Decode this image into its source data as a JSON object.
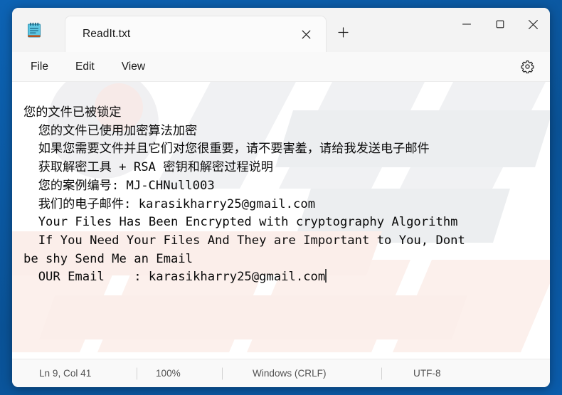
{
  "window": {
    "app_icon": "notepad-icon",
    "caption_buttons": [
      {
        "name": "minimize",
        "glyph": "minimize-icon"
      },
      {
        "name": "maximize",
        "glyph": "maximize-icon"
      },
      {
        "name": "close",
        "glyph": "close-icon"
      }
    ]
  },
  "tabs": {
    "active": {
      "label": "ReadIt.txt",
      "close_icon": "close-icon"
    },
    "new_tab_icon": "plus-icon"
  },
  "menubar": {
    "items": [
      {
        "label": "File"
      },
      {
        "label": "Edit"
      },
      {
        "label": "View"
      }
    ],
    "settings_icon": "gear-icon"
  },
  "editor": {
    "lines": [
      "您的文件已被锁定",
      "  您的文件已使用加密算法加密",
      "  如果您需要文件并且它们对您很重要，请不要害羞，请给我发送电子邮件",
      "  获取解密工具 + RSA 密钥和解密过程说明",
      "  您的案例编号: MJ-CHNull003",
      "  我们的电子邮件: karasikharry25@gmail.com",
      "  Your Files Has Been Encrypted with cryptography Algorithm",
      "  If You Need Your Files And They are Important to You, Dont",
      "be shy Send Me an Email",
      "  OUR Email    : karasikharry25@gmail.com"
    ],
    "full_text": "您的文件已被锁定\n  您的文件已使用加密算法加密\n  如果您需要文件并且它们对您很重要，请不要害羞，请给我发送电子邮件\n  获取解密工具 + RSA 密钥和解密过程说明\n  您的案例编号: MJ-CHNull003\n  我们的电子邮件: karasikharry25@gmail.com\n  Your Files Has Been Encrypted with cryptography Algorithm\n  If You Need Your Files And They are Important to You, Dont\nbe shy Send Me an Email\n  OUR Email    : karasikharry25@gmail.com",
    "case_number": "MJ-CHNull003",
    "email": "karasikharry25@gmail.com"
  },
  "statusbar": {
    "position": "Ln 9, Col 41",
    "zoom": "100%",
    "line_endings": "Windows (CRLF)",
    "encoding": "UTF-8"
  },
  "colors": {
    "desktop": "#0b5cab",
    "window_chrome": "#f3f3f3",
    "tab_active": "#fbfbfb",
    "editor_bg": "#ffffff",
    "statusbar_bg": "#f9f9f9",
    "text": "#0a0a0a",
    "status_text": "#525252",
    "icon_blue": "#5ec7e3",
    "icon_accent": "#b5531f"
  }
}
